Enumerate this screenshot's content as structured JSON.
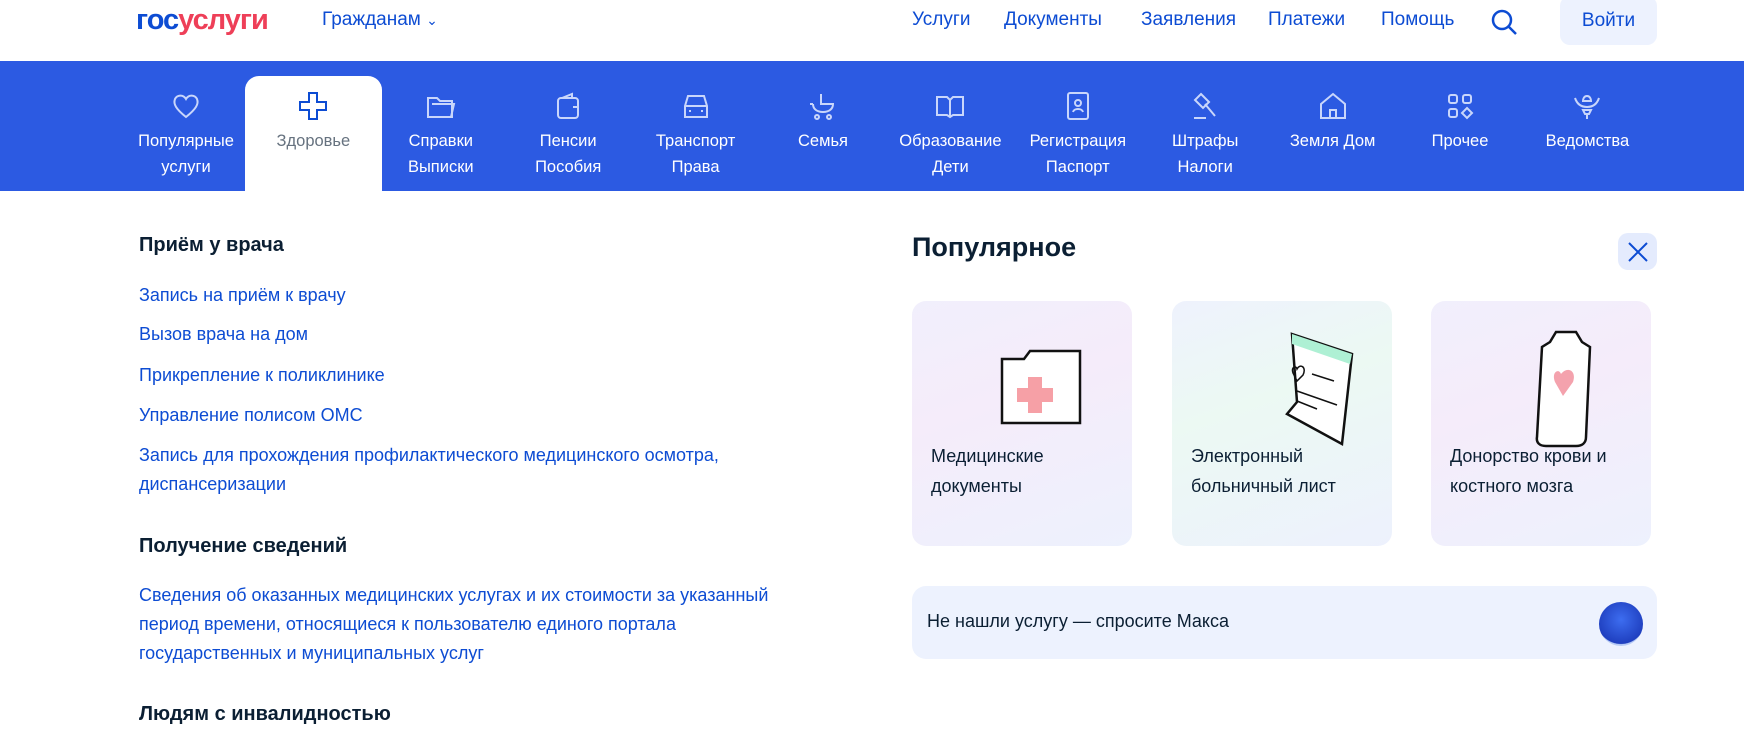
{
  "header": {
    "logo_part1": "гос",
    "logo_part2": "услуги",
    "audience": "Гражданам",
    "nav": [
      "Услуги",
      "Документы",
      "Заявления",
      "Платежи",
      "Помощь"
    ],
    "login": "Войти"
  },
  "categories": [
    {
      "line1": "Популярные",
      "line2": "услуги",
      "icon": "heart-icon"
    },
    {
      "line1": "Здоровье",
      "line2": "",
      "icon": "medical-cross-icon"
    },
    {
      "line1": "Справки",
      "line2": "Выписки",
      "icon": "folder-icon"
    },
    {
      "line1": "Пенсии",
      "line2": "Пособия",
      "icon": "wallet-icon"
    },
    {
      "line1": "Транспорт",
      "line2": "Права",
      "icon": "car-icon"
    },
    {
      "line1": "Семья",
      "line2": "",
      "icon": "stroller-icon"
    },
    {
      "line1": "Образование",
      "line2": "Дети",
      "icon": "book-icon"
    },
    {
      "line1": "Регистрация",
      "line2": "Паспорт",
      "icon": "passport-icon"
    },
    {
      "line1": "Штрафы",
      "line2": "Налоги",
      "icon": "gavel-icon"
    },
    {
      "line1": "Земля Дом",
      "line2": "",
      "icon": "house-icon"
    },
    {
      "line1": "Прочее",
      "line2": "",
      "icon": "grid-icon"
    },
    {
      "line1": "Ведомства",
      "line2": "",
      "icon": "emblem-icon"
    }
  ],
  "sections": [
    {
      "title": "Приём у врача",
      "links": [
        "Запись на приём к врачу",
        "Вызов врача на дом",
        "Прикрепление к поликлинике",
        "Управление полисом ОМС",
        "Запись для прохождения профилактического медицинского осмотра, диспансеризации"
      ]
    },
    {
      "title": "Получение сведений",
      "links": [
        "Сведения об оказанных медицинских услугах и их стоимости за указанный период времени, относящиеся к пользователю единого портала государственных и муниципальных услуг"
      ]
    },
    {
      "title": "Людям с инвалидностью",
      "links": []
    }
  ],
  "popular": {
    "title": "Популярное",
    "cards": [
      "Медицинские документы",
      "Электронный больничный лист",
      "Донорство крови и костного мозга"
    ]
  },
  "assistant": {
    "text": "Не нашли услугу — спросите Макса"
  },
  "colors": {
    "brand_blue": "#0d4cd3",
    "band": "#2c5ae2",
    "logo_red": "#ee3f58"
  }
}
